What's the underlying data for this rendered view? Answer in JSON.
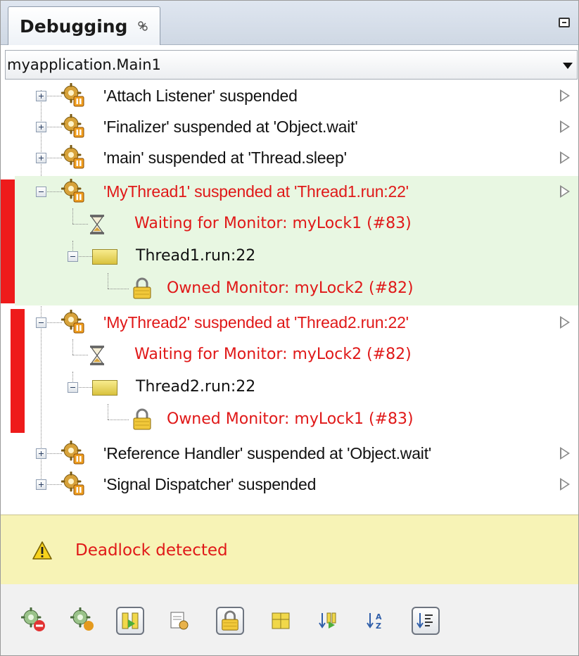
{
  "window": {
    "tab_title": "Debugging",
    "session": "myapplication.Main1"
  },
  "threads": [
    {
      "label": "'Attach Listener' suspended",
      "state": "collapsed"
    },
    {
      "label": "'Finalizer' suspended at 'Object.wait'",
      "state": "collapsed"
    },
    {
      "label": "'main' suspended at 'Thread.sleep'",
      "state": "collapsed"
    },
    {
      "label": "'MyThread1' suspended at 'Thread1.run:22'",
      "state": "expanded",
      "deadlocked": true,
      "waiting": "Waiting for Monitor: myLock1 (#83)",
      "frame": "Thread1.run:22",
      "owned": "Owned Monitor: myLock2 (#82)"
    },
    {
      "label": "'MyThread2' suspended at 'Thread2.run:22'",
      "state": "expanded",
      "deadlocked": true,
      "waiting": "Waiting for Monitor: myLock2 (#82)",
      "frame": "Thread2.run:22",
      "owned": "Owned Monitor: myLock1 (#83)"
    },
    {
      "label": "'Reference Handler' suspended at 'Object.wait'",
      "state": "collapsed"
    },
    {
      "label": "'Signal Dispatcher' suspended",
      "state": "collapsed"
    }
  ],
  "banner": {
    "text": "Deadlock detected",
    "icon": "warning-icon"
  },
  "toolbar": {
    "buttons": [
      {
        "icon": "resume-all-disabled-icon",
        "pressed": false
      },
      {
        "icon": "suspend-all-icon",
        "pressed": false
      },
      {
        "icon": "show-suspended-only-icon",
        "pressed": true
      },
      {
        "icon": "show-system-threads-icon",
        "pressed": false
      },
      {
        "icon": "show-monitors-icon",
        "pressed": true
      },
      {
        "icon": "show-thread-groups-icon",
        "pressed": false
      },
      {
        "icon": "sort-by-suspend-icon",
        "pressed": false
      },
      {
        "icon": "sort-alphabetically-icon",
        "pressed": false
      },
      {
        "icon": "sort-natural-icon",
        "pressed": true
      }
    ]
  },
  "colors": {
    "deadlock_text": "#e01818",
    "deadlock_bar": "#ee1b1b",
    "highlight_row": "#e8f7e2",
    "banner_bg": "#f7f3b6"
  }
}
